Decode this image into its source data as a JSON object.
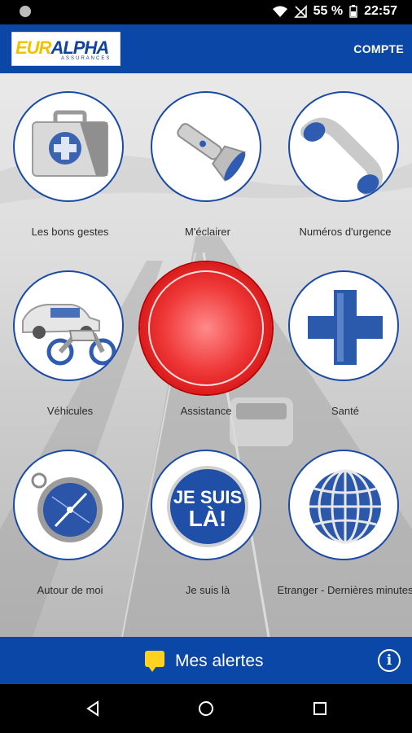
{
  "status_bar": {
    "battery": "55 %",
    "time": "22:57"
  },
  "header": {
    "logo_text_a": "EUR",
    "logo_text_b": "ALPHA",
    "logo_sub": "ASSURANCES",
    "account_label": "COMPTE"
  },
  "tiles": [
    {
      "label": "Les bons gestes"
    },
    {
      "label": "M'éclairer"
    },
    {
      "label": "Numéros d'urgence"
    },
    {
      "label": "Véhicules"
    },
    {
      "label": "Assistance"
    },
    {
      "label": "Santé"
    },
    {
      "label": "Autour de moi"
    },
    {
      "label": "Je suis là"
    },
    {
      "label": "Etranger - Dernières minutes"
    }
  ],
  "badge_text": {
    "line1": "JE SUIS",
    "line2": "LÀ!"
  },
  "footer": {
    "alerts_label": "Mes alertes"
  },
  "colors": {
    "brand_blue": "#0b47a6",
    "assist_red": "#e32222",
    "alert_yellow": "#ffd21f"
  }
}
